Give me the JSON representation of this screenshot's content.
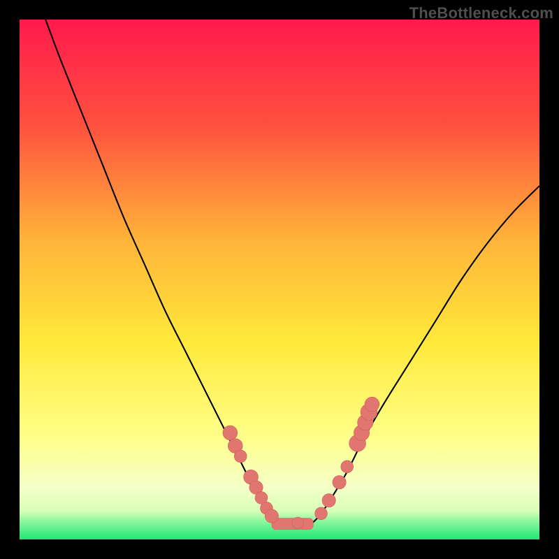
{
  "watermark": "TheBottleneck.com",
  "colors": {
    "black": "#000000",
    "curve": "#000000",
    "marker_fill": "#e0766f",
    "marker_stroke": "#cf5f58",
    "grad_top": "#ff1a4d",
    "grad_mid1": "#ff6f3a",
    "grad_mid2": "#ffd23a",
    "grad_mid3": "#ffff66",
    "grad_mid4": "#f8ffb0",
    "grad_bottom": "#2fe87e"
  },
  "chart_data": {
    "type": "line",
    "title": "",
    "xlabel": "",
    "ylabel": "",
    "xlim": [
      0,
      100
    ],
    "ylim": [
      0,
      100
    ],
    "grid": false,
    "curve_comment": "Approximate V-shaped bottleneck curve; y is % height from bottom, x is % width.",
    "series": [
      {
        "name": "bottleneck-curve",
        "x": [
          5,
          8,
          12,
          16,
          20,
          24,
          28,
          32,
          35,
          38,
          40,
          42,
          44,
          46,
          48,
          50,
          52,
          54,
          56,
          58,
          60,
          63,
          66,
          70,
          75,
          80,
          85,
          90,
          95,
          100
        ],
        "y": [
          100,
          92,
          82,
          72,
          62,
          53,
          44,
          36,
          30,
          24,
          20,
          16,
          12,
          8,
          5,
          3,
          3,
          3,
          3,
          5,
          8,
          13,
          19,
          26,
          34,
          42,
          50,
          57,
          63,
          68
        ]
      }
    ],
    "markers_comment": "Salmon dot markers clustered near the valley and on both rising arms.",
    "markers": [
      {
        "x": 40.5,
        "y": 20.5,
        "r": 1.4
      },
      {
        "x": 41.5,
        "y": 18.0,
        "r": 1.4
      },
      {
        "x": 42.5,
        "y": 16.0,
        "r": 1.2
      },
      {
        "x": 44.5,
        "y": 12.0,
        "r": 1.4
      },
      {
        "x": 45.5,
        "y": 10.0,
        "r": 1.3
      },
      {
        "x": 46.5,
        "y": 8.0,
        "r": 1.2
      },
      {
        "x": 47.5,
        "y": 6.0,
        "r": 1.2
      },
      {
        "x": 48.5,
        "y": 4.5,
        "r": 1.3
      },
      {
        "x": 53.5,
        "y": 3.2,
        "r": 1.1
      },
      {
        "x": 58.0,
        "y": 5.0,
        "r": 1.2
      },
      {
        "x": 59.5,
        "y": 7.5,
        "r": 1.3
      },
      {
        "x": 61.5,
        "y": 11.0,
        "r": 1.3
      },
      {
        "x": 63.0,
        "y": 14.0,
        "r": 1.2
      },
      {
        "x": 65.0,
        "y": 18.5,
        "r": 1.6
      },
      {
        "x": 65.8,
        "y": 20.5,
        "r": 1.5
      },
      {
        "x": 66.5,
        "y": 22.5,
        "r": 1.5
      },
      {
        "x": 67.2,
        "y": 24.5,
        "r": 1.6
      },
      {
        "x": 67.8,
        "y": 26.0,
        "r": 1.4
      }
    ],
    "baseline_segment": {
      "x1": 48.5,
      "x2": 56.5,
      "y": 3.0,
      "thickness": 2.2
    },
    "gradient_stops": [
      {
        "offset": 0.0,
        "color": "#ff1a4d"
      },
      {
        "offset": 0.2,
        "color": "#ff4f3f"
      },
      {
        "offset": 0.42,
        "color": "#ffb23a"
      },
      {
        "offset": 0.62,
        "color": "#ffe93a"
      },
      {
        "offset": 0.8,
        "color": "#ffff88"
      },
      {
        "offset": 0.9,
        "color": "#f5ffc8"
      },
      {
        "offset": 0.945,
        "color": "#d8ffb8"
      },
      {
        "offset": 0.965,
        "color": "#8cf79e"
      },
      {
        "offset": 1.0,
        "color": "#20e676"
      }
    ]
  }
}
